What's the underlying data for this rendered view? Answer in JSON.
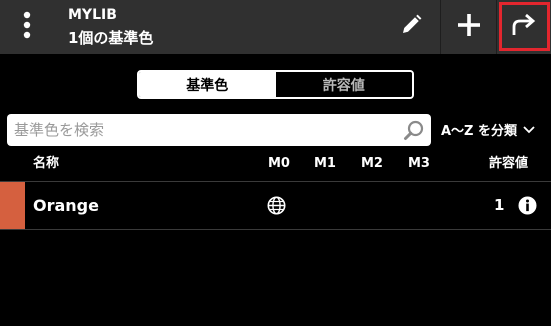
{
  "header": {
    "app_name": "MYLIB",
    "subtitle": "1個の基準色"
  },
  "tabs": [
    {
      "label": "基準色",
      "active": true
    },
    {
      "label": "許容値",
      "active": false
    }
  ],
  "search": {
    "placeholder": "基準色を検索",
    "value": ""
  },
  "sort": {
    "label": "A〜Z を分類"
  },
  "columns": {
    "name": "名称",
    "m0": "M0",
    "m1": "M1",
    "m2": "M2",
    "m3": "M3",
    "tolerance": "許容値"
  },
  "rows": [
    {
      "name": "Orange",
      "swatch_color": "#d5603f",
      "m0_icon": "globe-icon",
      "tolerance": "1"
    }
  ],
  "colors": {
    "header_bg": "#303030",
    "highlight_border": "#e3262e",
    "background": "#000000"
  }
}
